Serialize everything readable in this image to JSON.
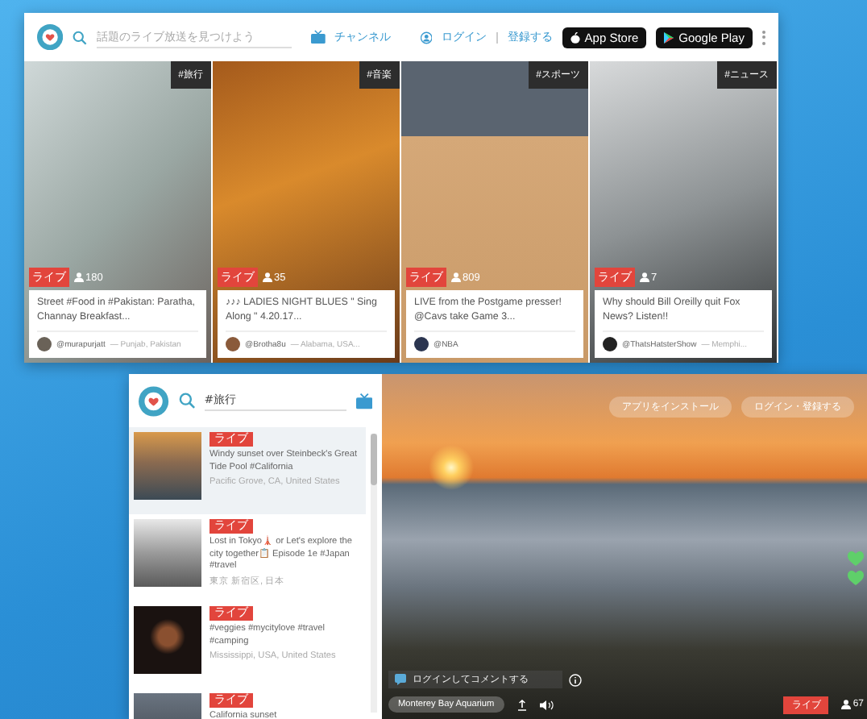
{
  "home_window": {
    "search": {
      "placeholder": "話題のライブ放送を見つけよう"
    },
    "channels_link": "チャンネル",
    "login_link": "ログイン",
    "signup_link": "登録する",
    "app_store": "App Store",
    "google_play": "Google Play",
    "cards": [
      {
        "tag": "#旅行",
        "live": "ライブ",
        "viewers": "180",
        "title": "Street #Food in #Pakistan: Paratha, Channay Breakfast...",
        "user": "@murapurjatt",
        "place": "— Punjab, Pakistan"
      },
      {
        "tag": "#音楽",
        "live": "ライブ",
        "viewers": "35",
        "title": "♪♪♪ LADIES NIGHT BLUES \" Sing Along \" 4.20.17...",
        "user": "@Brotha8u",
        "place": "— Alabama, USA..."
      },
      {
        "tag": "#スポーツ",
        "live": "ライブ",
        "viewers": "809",
        "title": "LIVE from the Postgame presser! @Cavs take Game 3...",
        "user": "@NBA"
      },
      {
        "tag": "#ニュース",
        "live": "ライブ",
        "viewers": "7",
        "title": "Why should Bill Oreilly quit Fox News? Listen!!",
        "user": "@ThatsHatsterShow",
        "place": "— Memphi..."
      }
    ]
  },
  "watch_window": {
    "search": {
      "value": "#旅行"
    },
    "broadcasts": [
      {
        "live": "ライブ",
        "title": "Windy sunset over Steinbeck's Great Tide Pool #California",
        "place": "Pacific Grove, CA, United States",
        "selected": true
      },
      {
        "live": "ライブ",
        "title": "Lost in Tokyo🗼 or Let's explore the city together📋 Episode 1e #Japan #travel",
        "place": "東京 新宿区, 日本",
        "selected": false
      },
      {
        "live": "ライブ",
        "title": "#veggies #mycitylove #travel #camping",
        "place": "Mississippi, USA, United States",
        "selected": false
      },
      {
        "live": "ライブ",
        "title": "California sunset",
        "selected": false
      }
    ],
    "install_button": "アプリをインストール",
    "login_button": "ログイン・登録する",
    "comment": {
      "placeholder": "ログインしてコメントする"
    },
    "location": "Monterey Bay Aquarium",
    "live": "ライブ",
    "viewers": "67"
  }
}
